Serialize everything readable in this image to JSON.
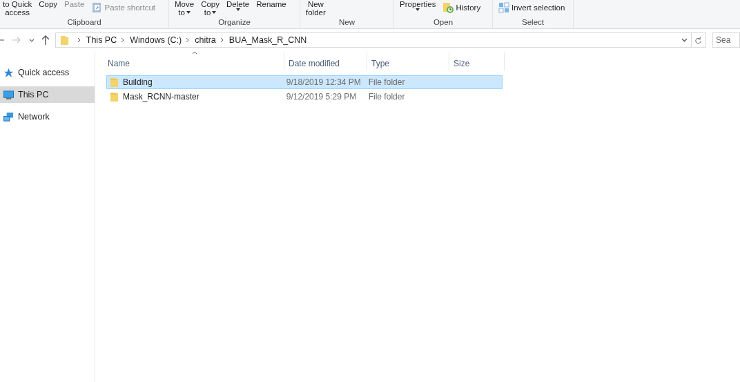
{
  "ribbon": {
    "groups": [
      {
        "label": "Clipboard",
        "buttons": [
          {
            "kind": "large",
            "lines": [
              "to Quick",
              "access"
            ],
            "dropdown": false,
            "disabled": false
          },
          {
            "kind": "large",
            "lines": [
              "Copy"
            ],
            "dropdown": false,
            "disabled": false
          },
          {
            "kind": "large",
            "lines": [
              "Paste"
            ],
            "dropdown": false,
            "disabled": true
          },
          {
            "kind": "small",
            "label": "Paste shortcut",
            "disabled": true
          }
        ]
      },
      {
        "label": "Organize",
        "buttons": [
          {
            "kind": "large",
            "lines": [
              "Move",
              "to"
            ],
            "dropdown": true,
            "disabled": false
          },
          {
            "kind": "large",
            "lines": [
              "Copy",
              "to"
            ],
            "dropdown": true,
            "disabled": false
          },
          {
            "kind": "large",
            "lines": [
              "Delete"
            ],
            "dropdown": true,
            "disabled": false
          },
          {
            "kind": "large",
            "lines": [
              "Rename"
            ],
            "dropdown": false,
            "disabled": false
          }
        ]
      },
      {
        "label": "New",
        "buttons": [
          {
            "kind": "large",
            "lines": [
              "New",
              "folder"
            ],
            "dropdown": false,
            "disabled": false
          }
        ]
      },
      {
        "label": "Open",
        "buttons": [
          {
            "kind": "large",
            "lines": [
              "Properties"
            ],
            "dropdown": true,
            "disabled": false
          },
          {
            "kind": "small",
            "label": "History",
            "disabled": false
          }
        ]
      },
      {
        "label": "Select",
        "buttons": [
          {
            "kind": "small",
            "label": "Invert selection",
            "disabled": false
          }
        ]
      }
    ]
  },
  "address_bar": {
    "path": [
      "This PC",
      "Windows (C:)",
      "chitra",
      "BUA_Mask_R_CNN"
    ]
  },
  "search": {
    "placeholder": "Sea"
  },
  "sidebar": {
    "items": [
      {
        "label": "Quick access",
        "selected": false
      },
      {
        "label": "This PC",
        "selected": true
      },
      {
        "label": "Network",
        "selected": false
      }
    ]
  },
  "table": {
    "columns": [
      "Name",
      "Date modified",
      "Type",
      "Size"
    ],
    "rows": [
      {
        "name": "Building",
        "date": "9/18/2019 12:34 PM",
        "type": "File folder",
        "selected": true
      },
      {
        "name": "Mask_RCNN-master",
        "date": "9/12/2019 5:29 PM",
        "type": "File folder",
        "selected": false
      }
    ]
  }
}
